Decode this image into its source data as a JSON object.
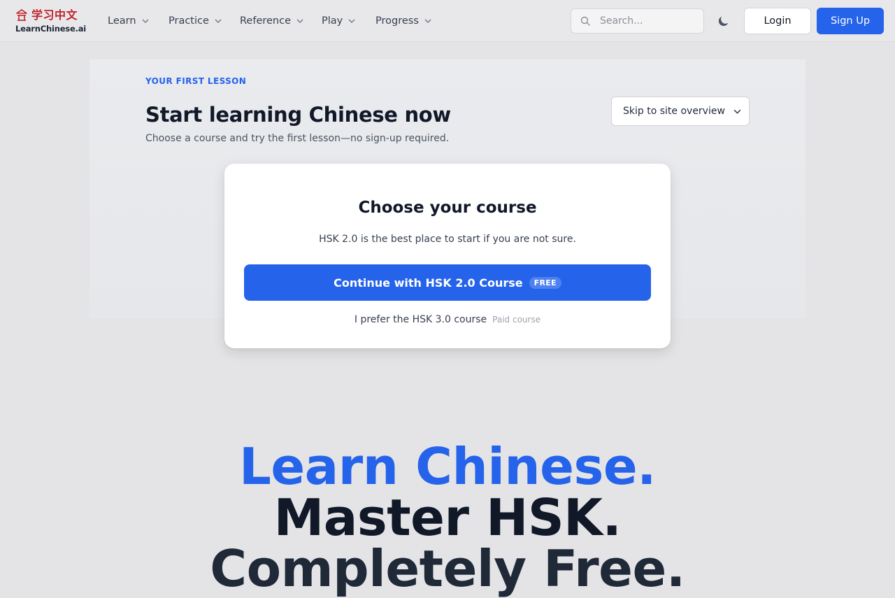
{
  "header": {
    "logo_cn": "学习中文",
    "logo_en": "LearnChinese.ai",
    "nav": [
      {
        "label": "Learn"
      },
      {
        "label": "Practice"
      },
      {
        "label": "Reference"
      },
      {
        "label": "Play"
      },
      {
        "label": "Progress"
      }
    ],
    "search_placeholder": "Search...",
    "login_label": "Login",
    "signup_label": "Sign Up"
  },
  "lesson": {
    "eyebrow": "YOUR FIRST LESSON",
    "title": "Start learning Chinese now",
    "subtitle": "Choose a course and try the first lesson—no sign-up required.",
    "skip_label": "Skip to site overview"
  },
  "course_card": {
    "title": "Choose your course",
    "description": "HSK 2.0 is the best place to start if you are not sure.",
    "cta_label": "Continue with HSK 2.0 Course",
    "cta_badge": "FREE",
    "alt_label": "I prefer the HSK 3.0 course",
    "alt_note": "Paid course"
  },
  "hero": {
    "line1": "Learn Chinese.",
    "line2": "Master HSK.",
    "line3": "Completely Free."
  },
  "colors": {
    "accent": "#2563eb",
    "logo_red": "#c0232b",
    "background": "#e4e4e6"
  },
  "icons": [
    "pagoda-logo-icon",
    "chevron-down-icon",
    "search-icon",
    "moon-icon"
  ]
}
